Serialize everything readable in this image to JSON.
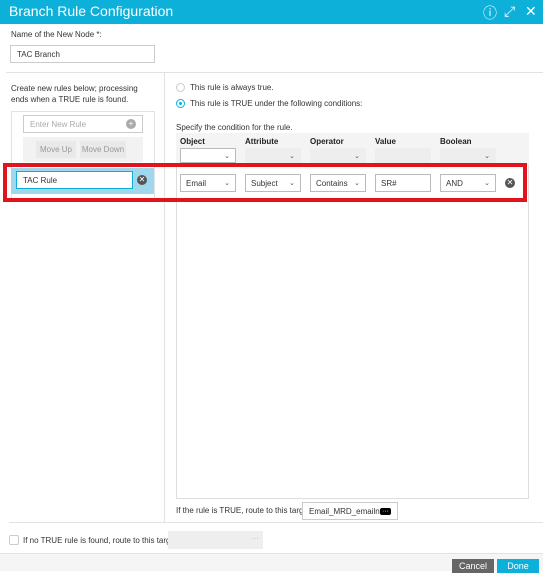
{
  "header": {
    "title": "Branch Rule Configuration",
    "help_icon": "help-icon",
    "expand_icon": "expand-icon",
    "close_icon": "close-icon"
  },
  "node": {
    "label": "Name of the New Node *:",
    "value": "TAC Branch"
  },
  "left": {
    "instructions": "Create new rules below; processing ends when a TRUE rule is found.",
    "new_rule_placeholder": "Enter New Rule",
    "move_up": "Move Up",
    "move_down": "Move Down",
    "rules": [
      {
        "name": "TAC Rule"
      }
    ]
  },
  "right": {
    "always_true": "This rule is always true.",
    "conditional": "This rule is TRUE under the following conditions:",
    "selected_option": "conditional",
    "specify": "Specify the condition for the rule.",
    "columns": [
      "Object",
      "Attribute",
      "Operator",
      "Value",
      "Boolean"
    ],
    "conditions": [
      {
        "object": "Email",
        "attribute": "Subject",
        "operator": "Contains",
        "value": "SR#",
        "boolean": "AND"
      }
    ],
    "route_label": "If the rule is TRUE, route to this target:",
    "route_value": "Email_MRD_emailn"
  },
  "fallback": {
    "label": "If no TRUE rule is found, route to this target:",
    "checked": false,
    "value": ""
  },
  "footer": {
    "cancel": "Cancel",
    "done": "Done"
  },
  "colors": {
    "accent": "#0cb0d9",
    "highlight": "#e0141c"
  }
}
